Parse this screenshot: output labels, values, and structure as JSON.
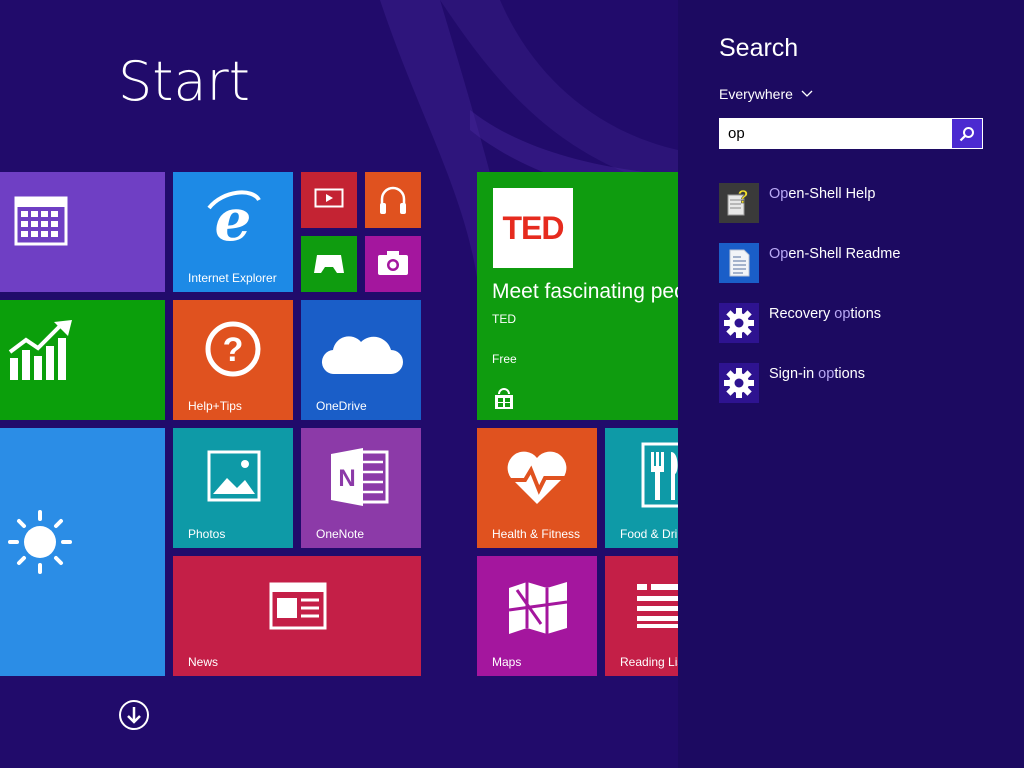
{
  "start": {
    "title": "Start",
    "tiles": [
      {
        "id": "calendar",
        "label": "",
        "color": "#6f3fc4",
        "icon": "calendar-icon"
      },
      {
        "id": "internet-explorer",
        "label": "Internet Explorer",
        "color": "#1d8ae6",
        "icon": "internet-explorer-icon"
      },
      {
        "id": "video",
        "label": "",
        "color": "#c42333",
        "icon": "video-icon"
      },
      {
        "id": "music",
        "label": "",
        "color": "#e0521f",
        "icon": "headphones-icon"
      },
      {
        "id": "games",
        "label": "",
        "color": "#0f9c0f",
        "icon": "xbox-controller-icon"
      },
      {
        "id": "camera",
        "label": "",
        "color": "#a4169e",
        "icon": "camera-icon"
      },
      {
        "id": "finance",
        "label": "",
        "color": "#0b9f0b",
        "icon": "finance-chart-icon"
      },
      {
        "id": "help-tips",
        "label": "Help+Tips",
        "color": "#e0521f",
        "icon": "question-icon"
      },
      {
        "id": "onedrive",
        "label": "OneDrive",
        "color": "#1a5ec8",
        "icon": "cloud-icon"
      },
      {
        "id": "weather",
        "label": "",
        "color": "#2b8de6",
        "icon": "sun-icon"
      },
      {
        "id": "photos",
        "label": "Photos",
        "color": "#0e9aa7",
        "icon": "photo-icon"
      },
      {
        "id": "onenote",
        "label": "OneNote",
        "color": "#8c3aa8",
        "icon": "onenote-icon"
      },
      {
        "id": "news",
        "label": "News",
        "color": "#c41f47",
        "icon": "news-icon"
      },
      {
        "id": "ted",
        "label": "",
        "color": "#0f9c0f",
        "icon": "ted-logo"
      },
      {
        "id": "health-fitness",
        "label": "Health & Fitness",
        "color": "#e0521f",
        "icon": "heart-icon"
      },
      {
        "id": "food-drink",
        "label": "Food & Dri",
        "color": "#0e9aa7",
        "icon": "fork-knife-icon"
      },
      {
        "id": "maps",
        "label": "Maps",
        "color": "#a4169e",
        "icon": "map-icon"
      },
      {
        "id": "reading-list",
        "label": "Reading Lis",
        "color": "#c41f47",
        "icon": "reading-list-icon"
      }
    ],
    "ted": {
      "logo_text": "TED",
      "headline": "Meet fascinating peo",
      "publisher": "TED",
      "price": "Free"
    }
  },
  "search": {
    "title": "Search",
    "scope": "Everywhere",
    "query": "op",
    "results": [
      {
        "label_hl": "Op",
        "label_rest": "en-Shell Help",
        "icon": "help-file-icon"
      },
      {
        "label_hl": "Op",
        "label_rest": "en-Shell Readme",
        "icon": "document-icon"
      },
      {
        "label_pre": "Recovery ",
        "label_hl": "op",
        "label_rest": "tions",
        "icon": "gear-icon"
      },
      {
        "label_pre": "Sign-in ",
        "label_hl": "op",
        "label_rest": "tions",
        "icon": "gear-icon"
      }
    ]
  },
  "colors": {
    "background": "#1f0a68",
    "search_pane": "#1c0a61",
    "search_button": "#4b2ad0",
    "highlight": "#b9a9f5"
  }
}
